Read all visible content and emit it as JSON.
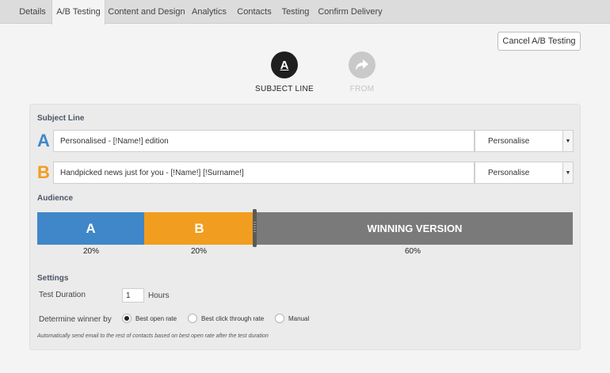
{
  "tabs": [
    {
      "label": "Details"
    },
    {
      "label": "A/B Testing"
    },
    {
      "label": "Content and Design"
    },
    {
      "label": "Analytics"
    },
    {
      "label": "Contacts"
    },
    {
      "label": "Testing"
    },
    {
      "label": "Confirm Delivery"
    }
  ],
  "active_tab": "A/B Testing",
  "cancel_button": "Cancel A/B Testing",
  "steps": [
    {
      "letter": "A",
      "label": "SUBJECT LINE",
      "icon": "letter-a-icon",
      "state": "active"
    },
    {
      "label": "FROM",
      "icon": "forward-arrow-icon",
      "state": "inactive"
    }
  ],
  "subject_line": {
    "title": "Subject Line",
    "variant_a": {
      "letter": "A",
      "value": "Personalised - [!Name!] edition",
      "button": "Personalise",
      "color": "#3f87c9"
    },
    "variant_b": {
      "letter": "B",
      "value": "Handpicked news just for you - [!Name!] [!Surname!]",
      "button": "Personalise",
      "color": "#f19d1f"
    }
  },
  "audience": {
    "title": "Audience",
    "segments": [
      {
        "label": "A",
        "percent": "20%",
        "share": 0.2,
        "color": "#3f87c9"
      },
      {
        "label": "B",
        "percent": "20%",
        "share": 0.2,
        "color": "#f19d1f"
      },
      {
        "label": "WINNING VERSION",
        "percent": "60%",
        "share": 0.6,
        "color": "#7a7a7a"
      }
    ]
  },
  "settings": {
    "title": "Settings",
    "test_duration_label": "Test Duration",
    "test_duration_value": "1",
    "test_duration_unit": "Hours",
    "winner_label": "Determine winner by",
    "options": [
      {
        "label": "Best open rate",
        "selected": true
      },
      {
        "label": "Best click through rate",
        "selected": false
      },
      {
        "label": "Manual",
        "selected": false
      }
    ],
    "note": "Automatically send email to the rest of contacts based on best open rate after the test duration"
  }
}
